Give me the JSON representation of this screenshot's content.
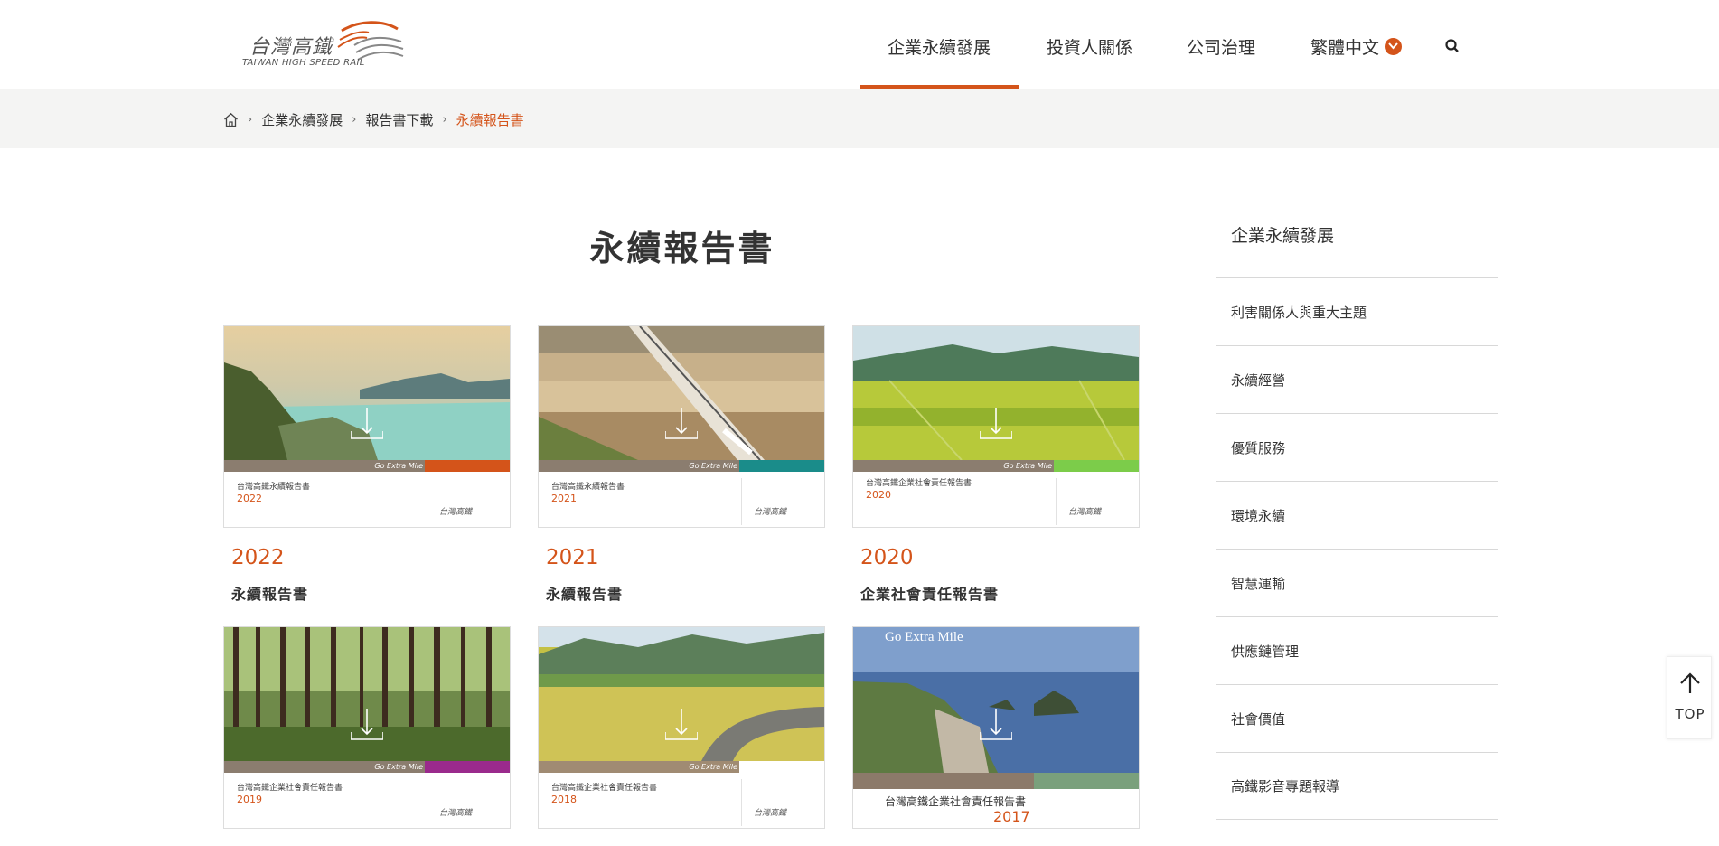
{
  "header": {
    "logo_cn": "台灣高鐵",
    "logo_en": "TAIWAN HIGH SPEED RAIL",
    "nav": [
      {
        "label": "企業永續發展"
      },
      {
        "label": "投資人關係"
      },
      {
        "label": "公司治理"
      },
      {
        "label": "繁體中文"
      }
    ],
    "search_icon": "search-icon",
    "accent": "#d4541a"
  },
  "breadcrumb": {
    "items": [
      "企業永續發展",
      "報告書下載"
    ],
    "current": "永續報告書"
  },
  "main": {
    "title": "永續報告書",
    "reports": [
      {
        "year": "2022",
        "name": "永續報告書",
        "cover_title": "台灣高鐵永續報告書",
        "cover_year": "2022",
        "strip_color": "#d4541a",
        "strip_text": "Go Extra Mile"
      },
      {
        "year": "2021",
        "name": "永續報告書",
        "cover_title": "台灣高鐵永續報告書",
        "cover_year": "2021",
        "strip_color": "#1a8c8a",
        "strip_text": "Go Extra Mile"
      },
      {
        "year": "2020",
        "name": "企業社會責任報告書",
        "cover_title": "台灣高鐵企業社會責任報告書",
        "cover_year": "2020",
        "strip_color": "#7ccc4a",
        "strip_text": "Go Extra Mile"
      },
      {
        "year": "2019",
        "name": "",
        "cover_title": "台灣高鐵企業社會責任報告書",
        "cover_year": "2019",
        "strip_color": "#9a2a8c",
        "strip_text": "Go Extra Mile"
      },
      {
        "year": "2018",
        "name": "",
        "cover_title": "台灣高鐵企業社會責任報告書",
        "cover_year": "2018",
        "strip_color": "#ffffff",
        "strip_text": "Go Extra Mile"
      },
      {
        "year": "2017",
        "name": "",
        "cover_title": "台灣高鐵企業社會責任報告書",
        "cover_year": "2017",
        "strip_color": "#7aa07c",
        "strip_text": "Go Extra Mile"
      }
    ]
  },
  "sidebar": {
    "title": "企業永續發展",
    "items": [
      {
        "label": "利害關係人與重大主題"
      },
      {
        "label": "永續經營"
      },
      {
        "label": "優質服務"
      },
      {
        "label": "環境永續"
      },
      {
        "label": "智慧運輸"
      },
      {
        "label": "供應鏈管理"
      },
      {
        "label": "社會價值"
      },
      {
        "label": "高鐵影音專題報導"
      }
    ]
  },
  "top_button": {
    "label": "TOP"
  }
}
